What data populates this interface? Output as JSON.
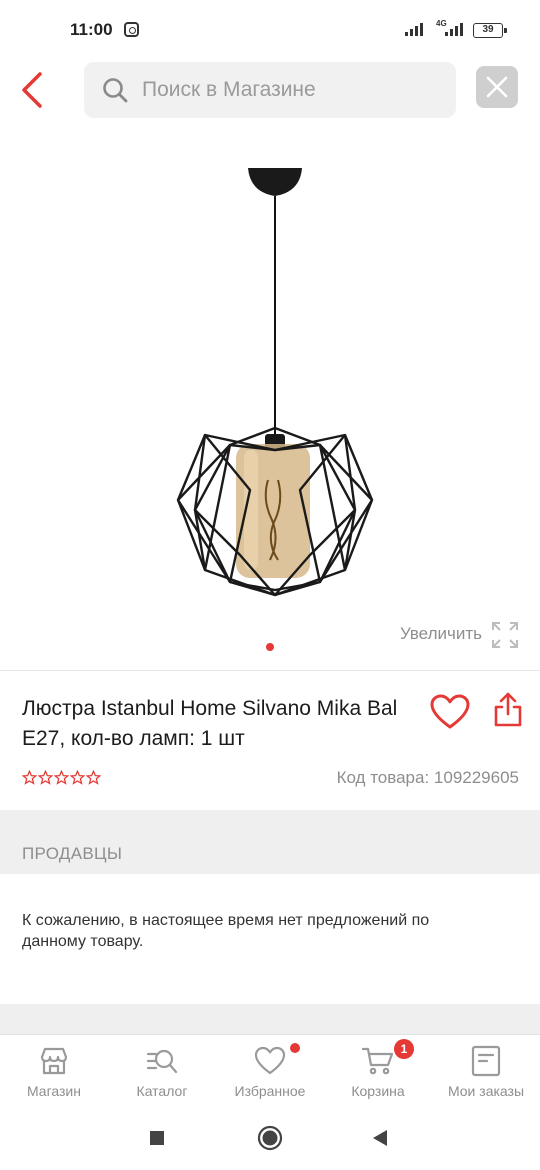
{
  "status_bar": {
    "time": "11:00",
    "network_label": "4G",
    "battery": "39"
  },
  "search": {
    "placeholder": "Поиск в Магазине"
  },
  "product": {
    "zoom_label": "Увеличить",
    "title": "Люстра Istanbul Home Silvano Mika Bal E27, кол-во ламп: 1 шт",
    "rating_stars": 0,
    "rating_max": 5,
    "sku": "Код товара: 109229605"
  },
  "sellers": {
    "title": "ПРОДАВЦЫ",
    "message": "К сожалению, в настоящее время нет предложений по данному товару."
  },
  "bottom_nav": {
    "items": [
      {
        "label": "Магазин",
        "icon": "store-icon"
      },
      {
        "label": "Каталог",
        "icon": "catalog-search-icon"
      },
      {
        "label": "Избранное",
        "icon": "heart-icon"
      },
      {
        "label": "Корзина",
        "icon": "cart-icon",
        "badge": "1"
      },
      {
        "label": "Мои заказы",
        "icon": "orders-icon"
      }
    ]
  },
  "colors": {
    "accent": "#e53935",
    "muted_text": "#8e8e8e",
    "section_bg": "#efefef"
  }
}
